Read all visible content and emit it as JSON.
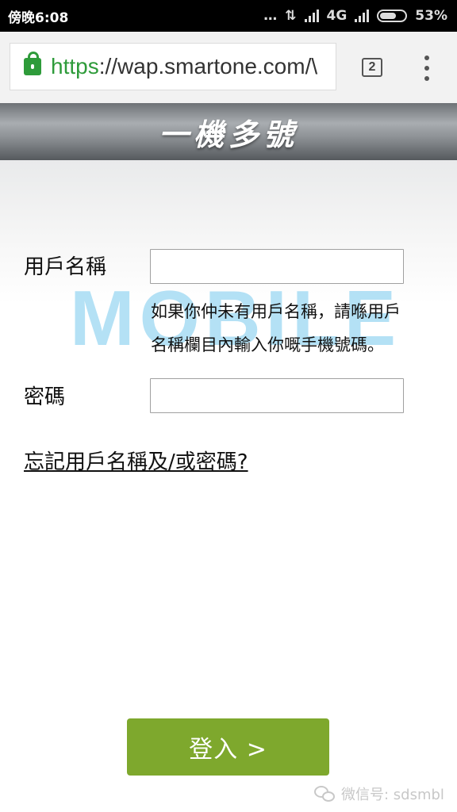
{
  "status_bar": {
    "time": "傍晚6:08",
    "network": "4G",
    "battery": "53%",
    "battery_level": 0.53
  },
  "browser": {
    "url_scheme": "https",
    "url_rest": "://wap.smartone.com/\\",
    "tab_count": "2",
    "icons": {
      "lock": "lock-icon",
      "menu": "overflow-menu-icon"
    }
  },
  "page": {
    "title": "一機多號",
    "watermark": "MOBILE",
    "username_label": "用戶名稱",
    "username_value": "",
    "hint_line1": "如果你仲未有用戶名稱，請喺用戶",
    "hint_line2": "名稱欄目內輸入你嘅手機號碼。",
    "password_label": "密碼",
    "password_value": "",
    "forgot_link": "忘記用戶名稱及/或密碼?",
    "login_button": "登入 >",
    "wechat_text": "微信号: sdsmbl"
  },
  "colors": {
    "accent_green": "#7ea82d",
    "lock_green": "#2e9b3a",
    "watermark_blue": "#a7dcf4"
  }
}
